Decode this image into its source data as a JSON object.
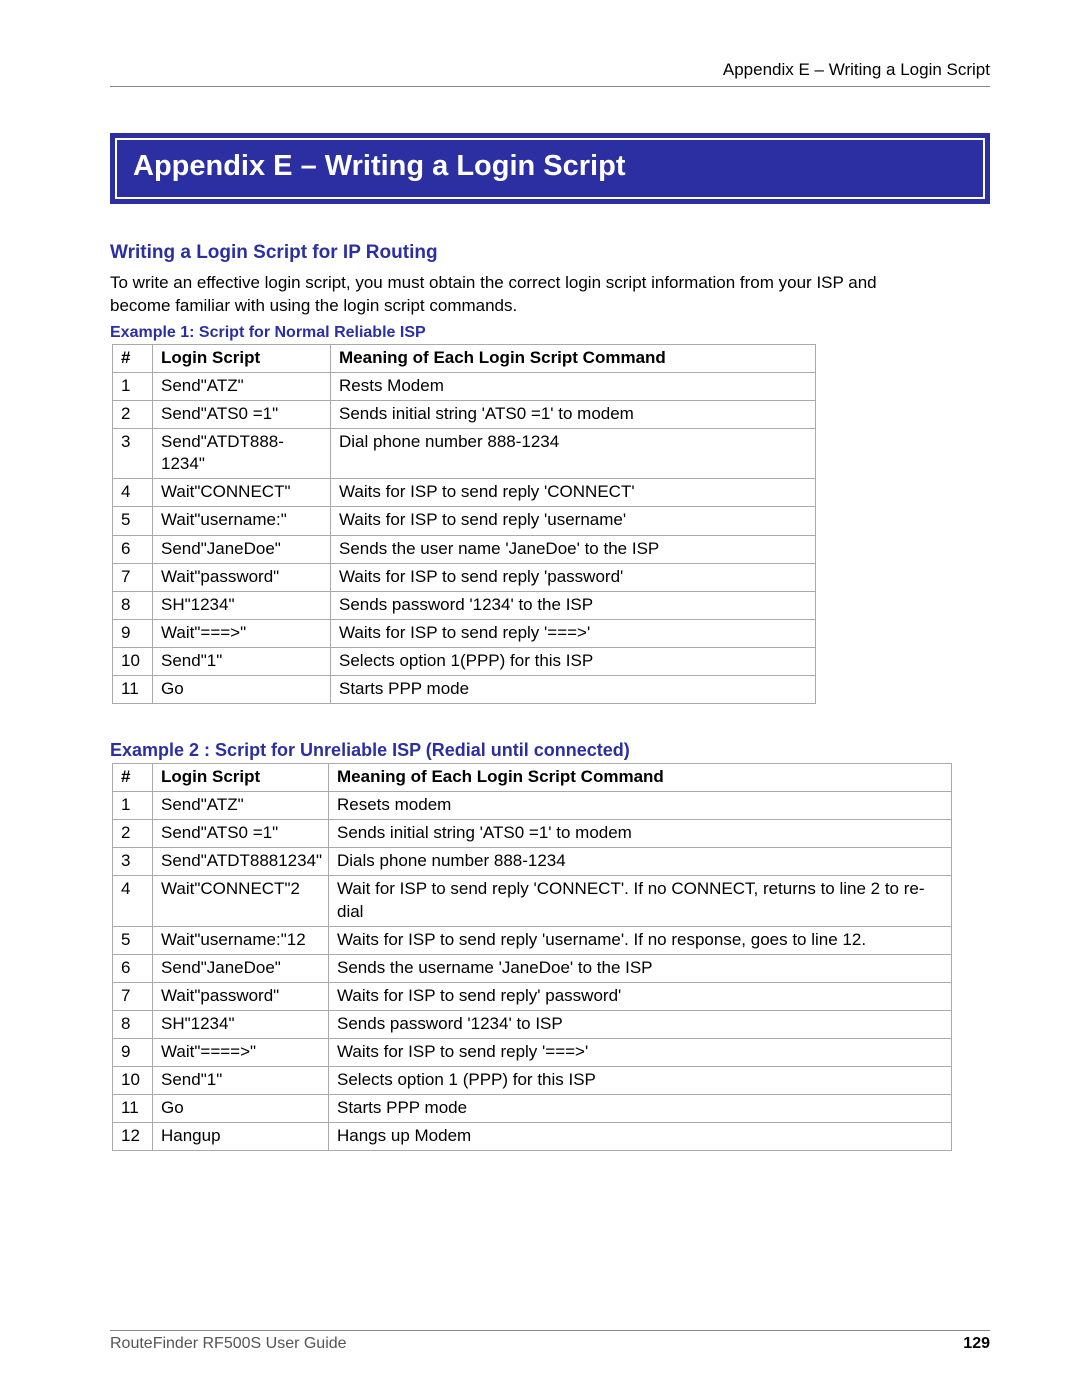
{
  "header": {
    "running_head": "Appendix E – Writing a Login Script"
  },
  "title": "Appendix E – Writing a Login Script",
  "section_heading": "Writing a Login Script for IP Routing",
  "intro_paragraph": "To write an effective login script, you must obtain the correct login script information from your ISP and become familiar with using the login script commands.",
  "example1": {
    "heading": "Example 1: Script for Normal Reliable ISP",
    "columns": [
      "#",
      "Login Script",
      "Meaning of Each Login Script Command"
    ],
    "rows": [
      {
        "n": "1",
        "script": "Send\"ATZ\"",
        "meaning": "Rests Modem"
      },
      {
        "n": "2",
        "script": "Send\"ATS0 =1\"",
        "meaning": "Sends initial string 'ATS0 =1' to modem"
      },
      {
        "n": "3",
        "script": "Send\"ATDT888-1234\"",
        "meaning": "Dial phone number 888-1234"
      },
      {
        "n": "4",
        "script": "Wait\"CONNECT\"",
        "meaning": "Waits for ISP to send reply 'CONNECT'"
      },
      {
        "n": "5",
        "script": "Wait\"username:\"",
        "meaning": "Waits for ISP to send reply 'username'"
      },
      {
        "n": "6",
        "script": "Send\"JaneDoe\"",
        "meaning": "Sends the user name 'JaneDoe' to the ISP"
      },
      {
        "n": "7",
        "script": "Wait\"password\"",
        "meaning": "Waits for ISP to send reply 'password'"
      },
      {
        "n": "8",
        "script": "SH\"1234\"",
        "meaning": "Sends password '1234' to the ISP"
      },
      {
        "n": "9",
        "script": "Wait\"===>\"",
        "meaning": "Waits for ISP to send reply '===>'"
      },
      {
        "n": "10",
        "script": "Send\"1\"",
        "meaning": "Selects option 1(PPP) for this ISP"
      },
      {
        "n": "11",
        "script": "Go",
        "meaning": "Starts PPP mode"
      }
    ]
  },
  "example2": {
    "heading": "Example 2 : Script for Unreliable ISP (Redial until connected)",
    "columns": [
      "#",
      "Login Script",
      "Meaning of Each Login Script Command"
    ],
    "rows": [
      {
        "n": "1",
        "script": "Send\"ATZ\"",
        "meaning": "Resets modem"
      },
      {
        "n": "2",
        "script": "Send\"ATS0 =1\"",
        "meaning": "Sends initial string 'ATS0 =1' to modem"
      },
      {
        "n": "3",
        "script": "Send\"ATDT8881234\"",
        "meaning": "Dials phone number 888-1234"
      },
      {
        "n": "4",
        "script": "Wait\"CONNECT\"2",
        "meaning": "Wait for ISP to send reply 'CONNECT'.  If no CONNECT, returns to line 2 to re-dial"
      },
      {
        "n": "5",
        "script": "Wait\"username:\"12",
        "meaning": "Waits for ISP to send reply 'username'.  If no response, goes to line 12."
      },
      {
        "n": "6",
        "script": "Send\"JaneDoe\"",
        "meaning": "Sends the username 'JaneDoe' to the ISP"
      },
      {
        "n": "7",
        "script": "Wait\"password\"",
        "meaning": "Waits for ISP to send reply' password'"
      },
      {
        "n": "8",
        "script": "SH\"1234\"",
        "meaning": "Sends password '1234' to ISP"
      },
      {
        "n": "9",
        "script": "Wait\"====>\"",
        "meaning": "Waits for ISP to send reply '===>'"
      },
      {
        "n": "10",
        "script": "Send\"1\"",
        "meaning": "Selects option 1 (PPP) for this ISP"
      },
      {
        "n": "11",
        "script": "Go",
        "meaning": "Starts PPP mode"
      },
      {
        "n": "12",
        "script": "Hangup",
        "meaning": "Hangs up Modem"
      }
    ]
  },
  "footer": {
    "doc": "RouteFinder RF500S User Guide",
    "page": "129"
  }
}
